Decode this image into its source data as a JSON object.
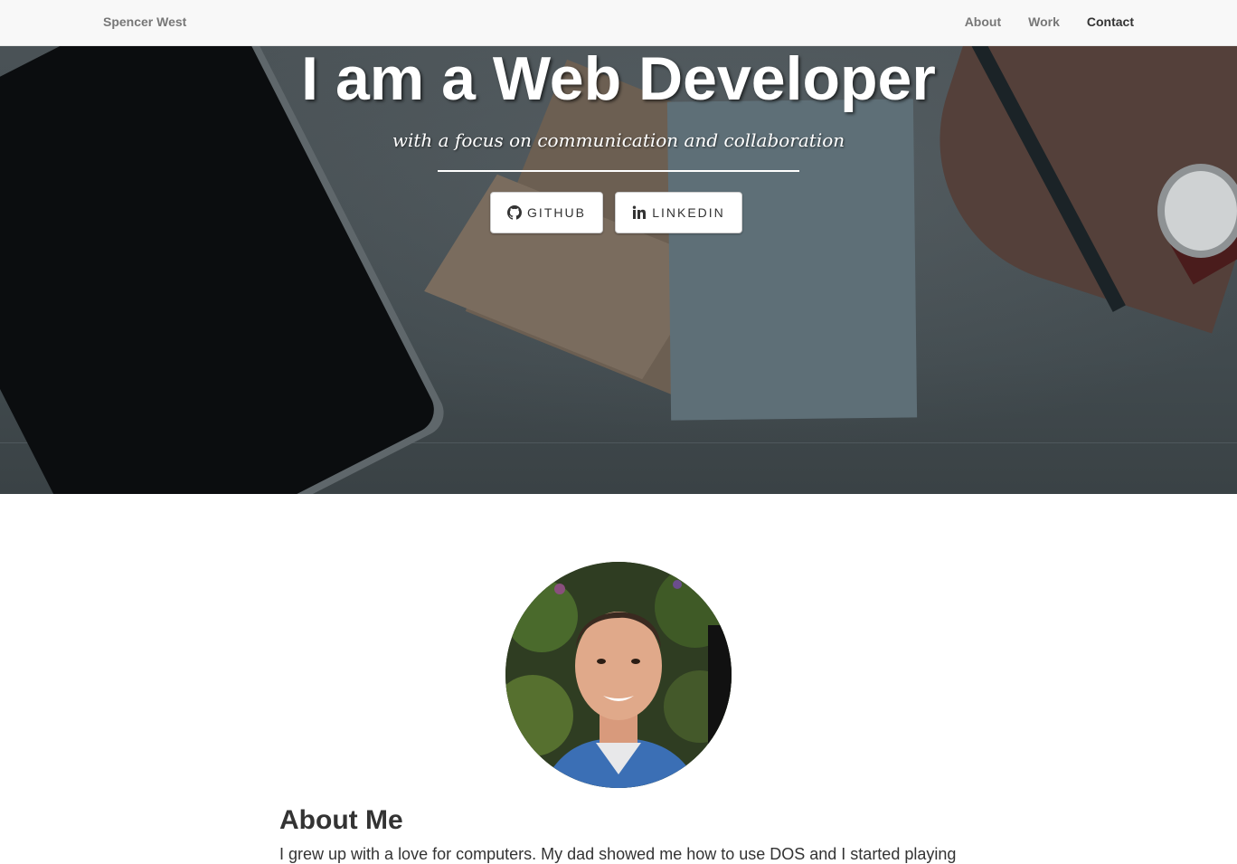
{
  "navbar": {
    "brand": "Spencer West",
    "links": [
      {
        "label": "About"
      },
      {
        "label": "Work"
      },
      {
        "label": "Contact"
      }
    ]
  },
  "hero": {
    "title": "I am a Web Developer",
    "subtitle": "with a focus on communication and collaboration",
    "buttons": [
      {
        "label": "GITHUB",
        "icon": "github-icon"
      },
      {
        "label": "LINKEDIN",
        "icon": "linkedin-icon"
      }
    ]
  },
  "about": {
    "title": "About Me",
    "text": "I grew up with a love for computers. My dad showed me how to use DOS and I started playing"
  },
  "colors": {
    "navbar_bg": "#f8f8f8",
    "navbar_text": "#777777",
    "hero_text": "#ffffff",
    "body_text": "#333333"
  }
}
